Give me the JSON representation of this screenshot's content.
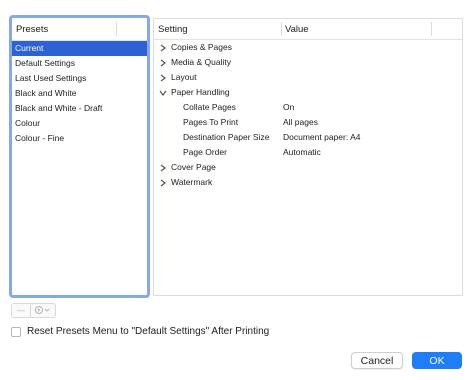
{
  "presets": {
    "header": "Presets",
    "items": [
      {
        "label": "Current",
        "selected": true
      },
      {
        "label": "Default Settings",
        "selected": false
      },
      {
        "label": "Last Used Settings",
        "selected": false
      },
      {
        "label": "Black and White",
        "selected": false
      },
      {
        "label": "Black and White - Draft",
        "selected": false
      },
      {
        "label": "Colour",
        "selected": false
      },
      {
        "label": "Colour - Fine",
        "selected": false
      }
    ]
  },
  "settings": {
    "columns": {
      "setting": "Setting",
      "value": "Value"
    },
    "rows": [
      {
        "label": "Copies & Pages",
        "value": "",
        "expanded": false
      },
      {
        "label": "Media & Quality",
        "value": "",
        "expanded": false
      },
      {
        "label": "Layout",
        "value": "",
        "expanded": false
      },
      {
        "label": "Paper Handling",
        "value": "",
        "expanded": true
      },
      {
        "label": "Collate Pages",
        "value": "On",
        "child": true
      },
      {
        "label": "Pages To Print",
        "value": "All pages",
        "child": true
      },
      {
        "label": "Destination Paper Size",
        "value": "Document paper: A4",
        "child": true
      },
      {
        "label": "Page Order",
        "value": "Automatic",
        "child": true
      },
      {
        "label": "Cover Page",
        "value": "",
        "expanded": false
      },
      {
        "label": "Watermark",
        "value": "",
        "expanded": false
      }
    ]
  },
  "controls": {
    "remove_symbol": "—",
    "action_icon": "action-menu-icon"
  },
  "reset_checkbox": {
    "label": "Reset Presets Menu to \"Default Settings\" After Printing",
    "checked": false
  },
  "buttons": {
    "cancel": "Cancel",
    "ok": "OK"
  },
  "colors": {
    "selection": "#2c62d6",
    "focus_ring": "#86a9e6",
    "default_button": "#1f7df5"
  }
}
